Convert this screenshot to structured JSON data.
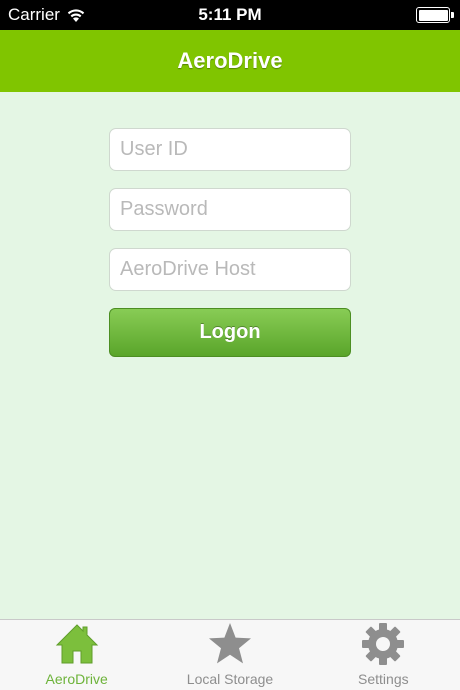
{
  "status_bar": {
    "carrier": "Carrier",
    "time": "5:11 PM"
  },
  "nav": {
    "title": "AeroDrive"
  },
  "form": {
    "user_id_placeholder": "User ID",
    "password_placeholder": "Password",
    "host_placeholder": "AeroDrive Host",
    "logon_label": "Logon"
  },
  "tabs": [
    {
      "label": "AeroDrive",
      "icon": "home-icon",
      "active": true
    },
    {
      "label": "Local Storage",
      "icon": "star-icon",
      "active": false
    },
    {
      "label": "Settings",
      "icon": "gear-icon",
      "active": false
    }
  ],
  "colors": {
    "nav_bar": "#80c500",
    "background": "#e4f6e4",
    "button": "#6db33a",
    "active_tab": "#6db33a",
    "inactive_tab": "#8e8e8e"
  }
}
